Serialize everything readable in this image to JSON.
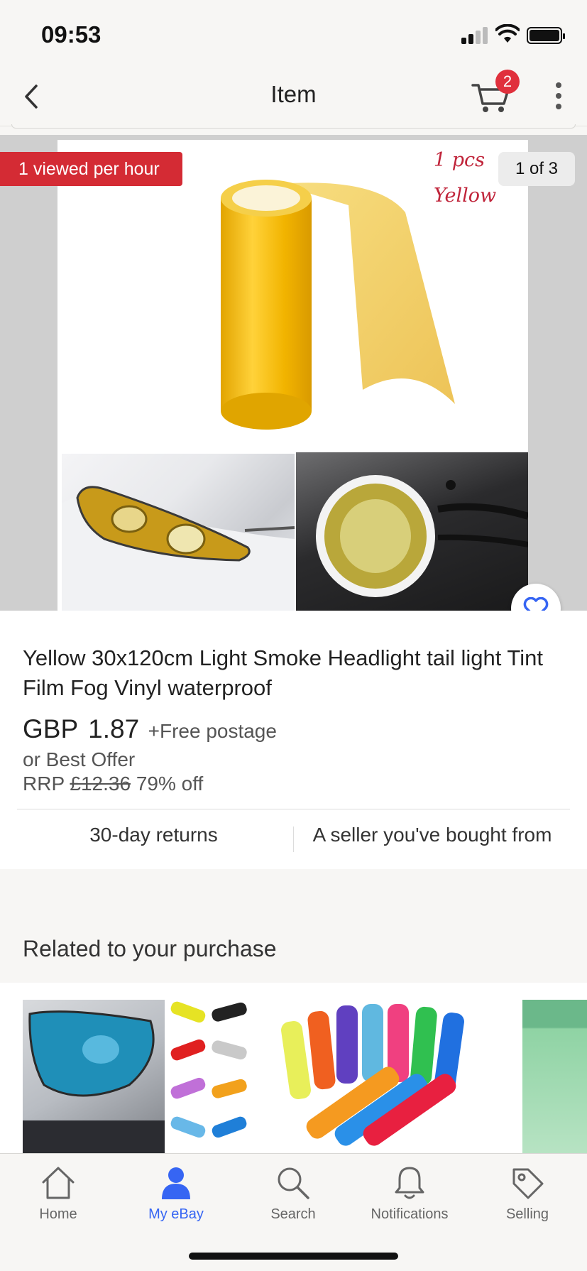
{
  "status_bar": {
    "time": "09:53"
  },
  "header": {
    "title": "Item",
    "cart_count": "2"
  },
  "gallery": {
    "views_badge": "1 viewed per hour",
    "counter": "1 of 3",
    "image_caption_line1": "1 pcs",
    "image_caption_line2": "Yellow"
  },
  "item": {
    "title": "Yellow 30x120cm Light Smoke Headlight tail light Tint Film Fog Vinyl waterproof",
    "currency": "GBP",
    "price": "1.87",
    "postage": "+Free postage",
    "best_offer": "or Best Offer",
    "rrp_label": "RRP",
    "rrp_value": "£12.36",
    "discount": "79% off",
    "returns": "30-day returns",
    "seller_note": "A seller you've bought from"
  },
  "related": {
    "title": "Related to your purchase"
  },
  "tabbar": {
    "tabs": [
      {
        "label": "Home",
        "icon": "home-icon"
      },
      {
        "label": "My eBay",
        "icon": "user-icon"
      },
      {
        "label": "Search",
        "icon": "search-icon"
      },
      {
        "label": "Notifications",
        "icon": "bell-icon"
      },
      {
        "label": "Selling",
        "icon": "tag-icon"
      }
    ],
    "active": "My eBay"
  },
  "colors": {
    "accent": "#3665f3",
    "badge_red": "#d42b34",
    "cart_badge": "#e0303c"
  }
}
